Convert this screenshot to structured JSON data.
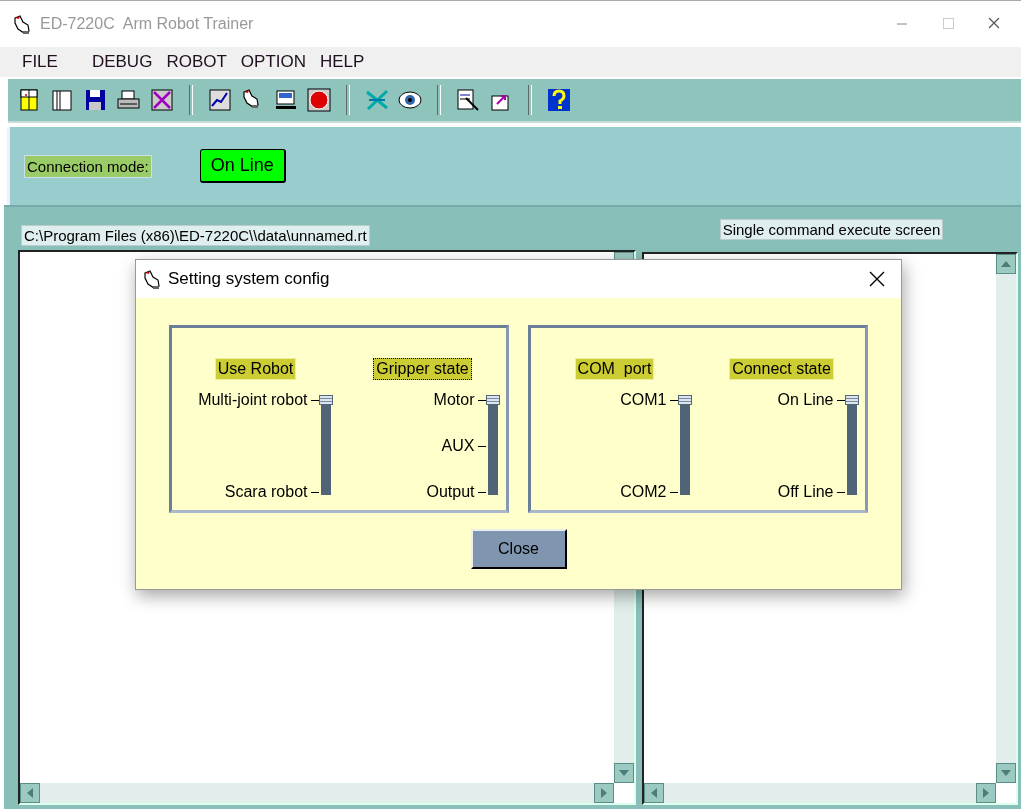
{
  "window": {
    "title": "ED-7220C  Arm Robot Trainer"
  },
  "menu": [
    "FILE",
    "DEBUG",
    "ROBOT",
    "OPTION",
    "HELP"
  ],
  "connection": {
    "label": "Connection mode:",
    "button": "On Line"
  },
  "program_panel": {
    "path": "C:\\Program Files (x86)\\ED-7220C\\\\data\\unnamed.rt"
  },
  "command_panel": {
    "title": "Single command execute screen"
  },
  "dialog": {
    "title": "Setting system config",
    "groups": [
      {
        "sliders": [
          {
            "heading": "Use Robot",
            "focused": false,
            "level": 1,
            "options": [
              "Multi-joint robot",
              "Scara robot"
            ]
          },
          {
            "heading": "Gripper state",
            "focused": true,
            "level": 1,
            "options": [
              "Motor",
              "AUX",
              "Output"
            ]
          }
        ]
      },
      {
        "sliders": [
          {
            "heading": "COM  port",
            "focused": false,
            "level": 1,
            "options": [
              "COM1",
              "COM2"
            ]
          },
          {
            "heading": "Connect state",
            "focused": false,
            "level": 1,
            "options": [
              "On Line",
              "Off Line"
            ]
          }
        ]
      }
    ],
    "close_button": "Close"
  }
}
